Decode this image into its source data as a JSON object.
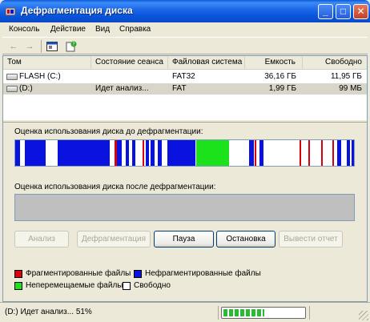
{
  "window": {
    "title": "Дефрагментация диска"
  },
  "titlebar": {
    "minimize": "_",
    "maximize": "□",
    "close": "✕"
  },
  "menu": [
    "Консоль",
    "Действие",
    "Вид",
    "Справка"
  ],
  "toolbar": {
    "icons": [
      "back-arrow-icon",
      "forward-arrow-icon",
      "console-view-icon",
      "help-icon"
    ]
  },
  "volumes": {
    "columns": [
      "Том",
      "Состояние сеанса",
      "Файловая система",
      "Емкость",
      "Свободно"
    ],
    "rows": [
      {
        "volume": "FLASH (C:)",
        "status": "",
        "fs": "FAT32",
        "capacity": "36,16 ГБ",
        "free": "11,95 ГБ"
      },
      {
        "volume": "(D:)",
        "status": "Идет анализ...",
        "fs": "FAT",
        "capacity": "1,99 ГБ",
        "free": "99 МБ"
      }
    ]
  },
  "maps": {
    "before_label": "Оценка использования диска до дефрагментации:",
    "after_label": "Оценка использования диска после дефрагментации:"
  },
  "fragment_map": [
    {
      "t": "b",
      "s": 0,
      "w": 6
    },
    {
      "t": "b",
      "s": 12,
      "w": 26
    },
    {
      "t": "b",
      "s": 53,
      "w": 65
    },
    {
      "t": "r",
      "s": 124,
      "w": 3
    },
    {
      "t": "b",
      "s": 127,
      "w": 6
    },
    {
      "t": "b",
      "s": 138,
      "w": 4
    },
    {
      "t": "b",
      "s": 146,
      "w": 4
    },
    {
      "t": "r",
      "s": 159,
      "w": 2
    },
    {
      "t": "b",
      "s": 163,
      "w": 4
    },
    {
      "t": "b",
      "s": 169,
      "w": 5
    },
    {
      "t": "b",
      "s": 178,
      "w": 5
    },
    {
      "t": "b",
      "s": 190,
      "w": 35
    },
    {
      "t": "g",
      "s": 226,
      "w": 41
    },
    {
      "t": "b",
      "s": 292,
      "w": 6
    },
    {
      "t": "r",
      "s": 299,
      "w": 2
    },
    {
      "t": "b",
      "s": 305,
      "w": 5
    },
    {
      "t": "r",
      "s": 355,
      "w": 2
    },
    {
      "t": "r",
      "s": 366,
      "w": 2
    },
    {
      "t": "r",
      "s": 382,
      "w": 2
    },
    {
      "t": "r",
      "s": 396,
      "w": 2
    },
    {
      "t": "b",
      "s": 402,
      "w": 5
    },
    {
      "t": "b",
      "s": 414,
      "w": 4
    },
    {
      "t": "b",
      "s": 420,
      "w": 3
    }
  ],
  "colors": {
    "fragmented": "#D8000C",
    "contiguous": "#0A12E0",
    "unmovable": "#1CE21C",
    "free": "#FFFFFF",
    "accent": "#0A5BD8"
  },
  "buttons": {
    "analyze": "Анализ",
    "defragment": "Дефрагментация",
    "pause": "Пауза",
    "stop": "Остановка",
    "report": "Вывести отчет"
  },
  "legend": {
    "fragmented": "Фрагментированные файлы",
    "contiguous": "Нефрагментированные файлы",
    "unmovable": "Неперемещаемые файлы",
    "free": "Свободно"
  },
  "status": {
    "text": "(D:) Идет анализ... 51%",
    "progress": 0.51
  }
}
